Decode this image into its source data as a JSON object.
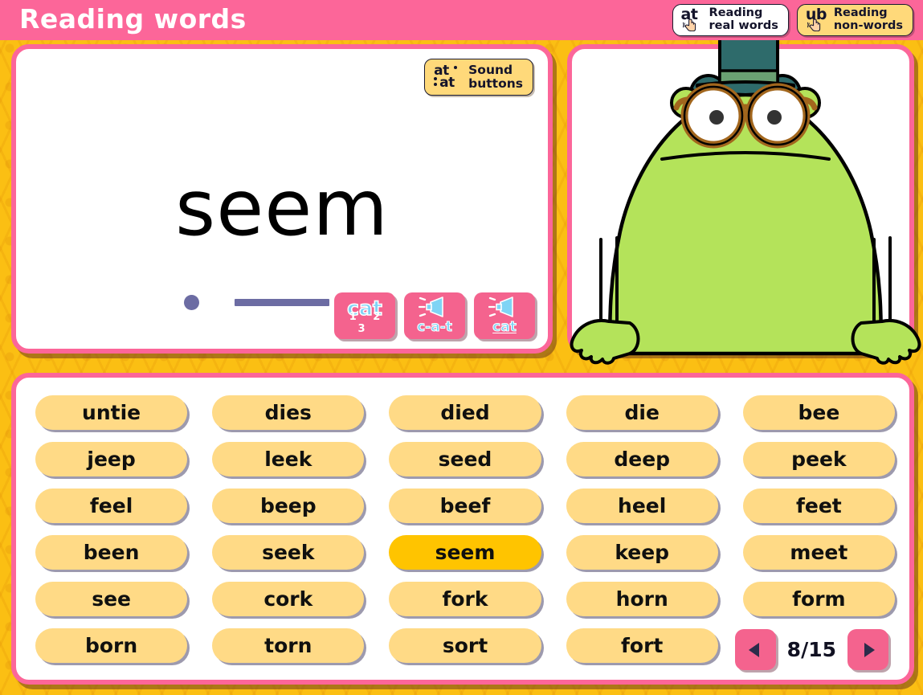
{
  "header": {
    "title": "Reading words",
    "mode_buttons": [
      {
        "icon": "at-hand-icon",
        "icon_letters": "at",
        "label": "Reading\nreal words",
        "style": "white",
        "selected": true
      },
      {
        "icon": "ub-hand-icon",
        "icon_letters": "ub",
        "label": "Reading\nnon-words",
        "style": "yellow",
        "selected": false
      }
    ]
  },
  "word_panel": {
    "sound_buttons_chip": {
      "icon": "sound-buttons-icon",
      "icon_letters_top": "at",
      "icon_letters_bottom": "at",
      "label": "Sound\nbuttons"
    },
    "current_word": "seem",
    "phonemes": [
      {
        "type": "dot",
        "grapheme": "s"
      },
      {
        "type": "bar",
        "grapheme": "ee"
      },
      {
        "type": "dot",
        "grapheme": "m"
      }
    ],
    "actions": [
      {
        "name": "sound-buttons-toggle-button",
        "icon": "cat-123-icon",
        "main": "cat",
        "sub": "1 2 3",
        "kind": "numbers"
      },
      {
        "name": "sound-out-word-button",
        "icon": "speaker-icon",
        "main": "",
        "sub": "c-a-t",
        "kind": "speaker"
      },
      {
        "name": "say-word-button",
        "icon": "speaker-icon",
        "main": "",
        "sub": "cat",
        "kind": "speaker-underlined"
      }
    ]
  },
  "character_panel": {
    "character": "frog-teacher",
    "description": "green frog with teal top hat and round brown glasses",
    "colors": {
      "body": "#B4E35A",
      "hat": "#2E6B6B",
      "hat_band": "#6AA072",
      "glasses": "#A2661D",
      "outline": "#000000"
    }
  },
  "grid": {
    "columns": 5,
    "words": [
      "untie",
      "dies",
      "died",
      "die",
      "bee",
      "jeep",
      "leek",
      "seed",
      "deep",
      "peek",
      "feel",
      "beep",
      "beef",
      "heel",
      "feet",
      "been",
      "seek",
      "seem",
      "keep",
      "meet",
      "see",
      "cork",
      "fork",
      "horn",
      "form",
      "born",
      "torn",
      "sort",
      "fort",
      ""
    ],
    "active_word": "seem"
  },
  "pager": {
    "prev_label": "prev-page",
    "next_label": "next-page",
    "count": "8/15",
    "current": 8,
    "total": 15
  },
  "colors": {
    "background_gold": "#FBBF13",
    "header_pink": "#FC6699",
    "panel_border_pink": "#FC6699",
    "chip_yellow": "#FFDA86",
    "chip_active_gold": "#FFC400",
    "action_pink": "#F4638E",
    "phoneme_purple": "#6C6CA3"
  }
}
